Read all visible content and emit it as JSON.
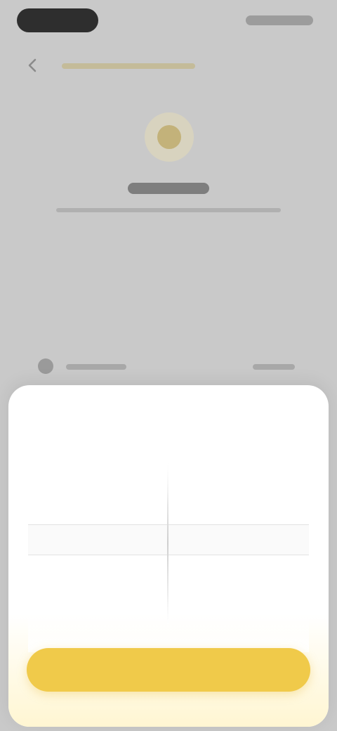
{
  "sheet": {
    "title": "",
    "confirm_label": "",
    "picker": {
      "left_column": [],
      "right_column": []
    }
  },
  "colors": {
    "accent": "#f0ca4a",
    "backdrop": "#c9c9c9",
    "sheet": "#ffffff"
  },
  "icons": {
    "back": "chevron-left-icon",
    "emblem": "badge-icon"
  }
}
